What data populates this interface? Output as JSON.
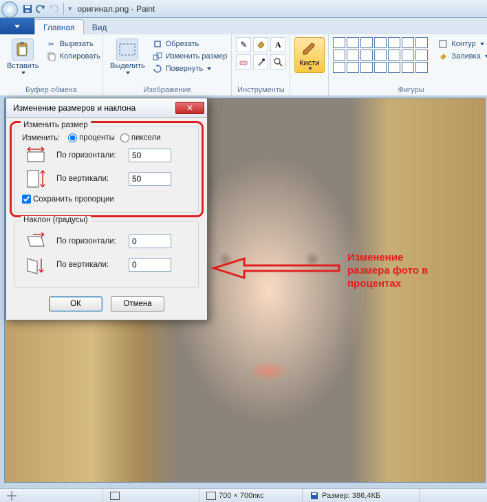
{
  "window": {
    "title": "оригинал.png - Paint"
  },
  "tabs": {
    "home": "Главная",
    "view": "Вид"
  },
  "ribbon": {
    "clipboard": {
      "paste": "Вставить",
      "cut": "Вырезать",
      "copy": "Копировать",
      "label": "Буфер обмена"
    },
    "image": {
      "select": "Выделить",
      "crop": "Обрезать",
      "resize": "Изменить размер",
      "rotate": "Повернуть",
      "label": "Изображение"
    },
    "tools": {
      "label": "Инструменты"
    },
    "brushes": {
      "button": "Кисти"
    },
    "shapes": {
      "label": "Фигуры",
      "outline": "Контур",
      "fill": "Заливка"
    }
  },
  "dialog": {
    "title": "Изменение размеров и наклона",
    "resize": {
      "legend": "Изменить размер",
      "by_label": "Изменить:",
      "percent": "проценты",
      "pixels": "пиксели",
      "horizontal_label": "По горизонтали:",
      "horizontal_value": "50",
      "vertical_label": "По вертикали:",
      "vertical_value": "50",
      "keep_ratio": "Сохранить пропорции"
    },
    "skew": {
      "legend": "Наклон (градусы)",
      "horizontal_label": "По горизонтали:",
      "horizontal_value": "0",
      "vertical_label": "По вертикали:",
      "vertical_value": "0"
    },
    "ok": "ОК",
    "cancel": "Отмена"
  },
  "annotation": {
    "line1": "Изменение",
    "line2": "размера фото в",
    "line3": "процентах"
  },
  "statusbar": {
    "canvas_size": "700 × 700пкс",
    "file_size": "Размер: 386,4КБ"
  }
}
